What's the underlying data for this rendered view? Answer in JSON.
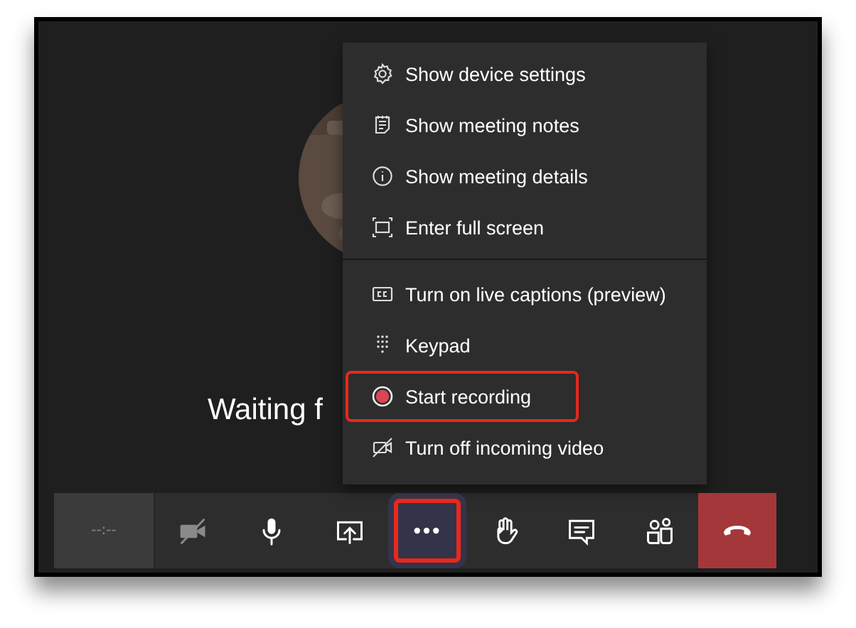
{
  "stage": {
    "status": "Waiting f"
  },
  "menu": {
    "groups": [
      [
        {
          "label": "Show device settings",
          "highlighted": false
        },
        {
          "label": "Show meeting notes",
          "highlighted": false
        },
        {
          "label": "Show meeting details",
          "highlighted": false
        },
        {
          "label": "Enter full screen",
          "highlighted": false
        }
      ],
      [
        {
          "label": "Turn on live captions (preview)",
          "highlighted": false
        },
        {
          "label": "Keypad",
          "highlighted": false
        },
        {
          "label": "Start recording",
          "highlighted": true
        },
        {
          "label": "Turn off incoming video",
          "highlighted": false
        }
      ]
    ]
  },
  "toolbar": {
    "timer": "--:--",
    "buttons": [
      {
        "kind": "button",
        "disabled": true,
        "selected": false,
        "highlighted": false
      },
      {
        "kind": "button",
        "disabled": false,
        "selected": false,
        "highlighted": false
      },
      {
        "kind": "button",
        "disabled": false,
        "selected": false,
        "highlighted": false
      },
      {
        "kind": "button",
        "disabled": false,
        "selected": true,
        "highlighted": true
      },
      {
        "kind": "button",
        "disabled": false,
        "selected": false,
        "highlighted": false
      },
      {
        "kind": "button",
        "disabled": false,
        "selected": false,
        "highlighted": false
      },
      {
        "kind": "button",
        "disabled": false,
        "selected": false,
        "highlighted": false
      },
      {
        "kind": "hangup",
        "highlighted": false
      }
    ]
  }
}
